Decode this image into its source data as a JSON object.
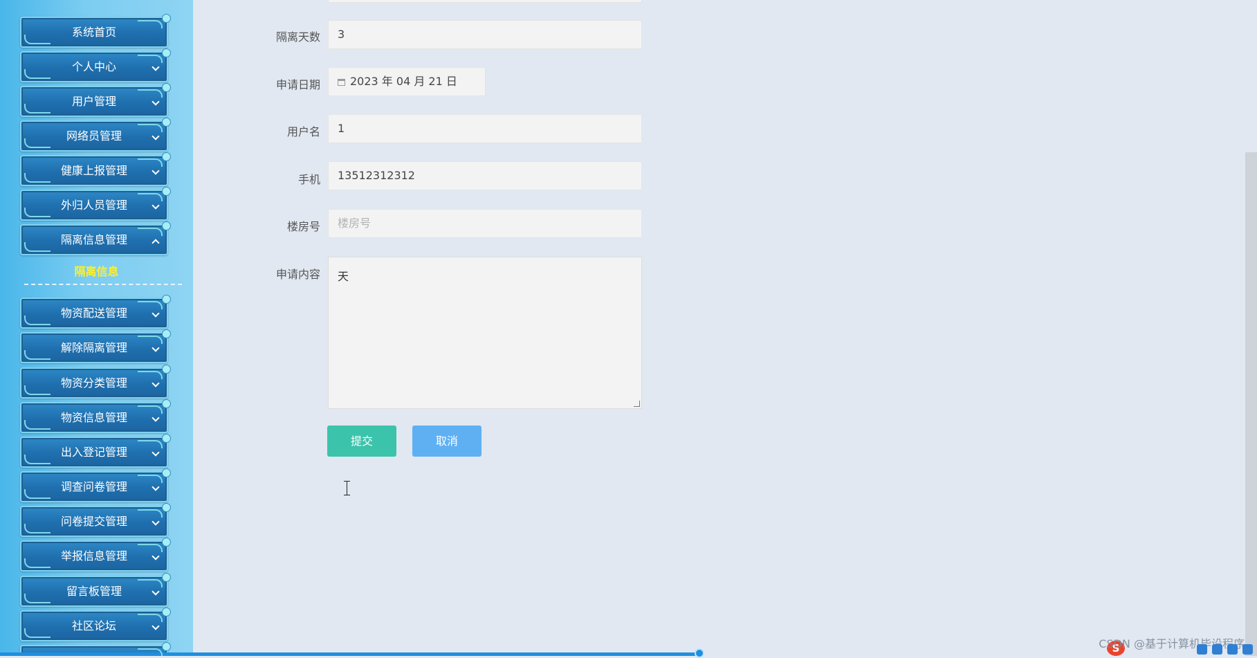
{
  "sidebar": {
    "items": [
      {
        "label": "系统首页"
      },
      {
        "label": "个人中心"
      },
      {
        "label": "用户管理"
      },
      {
        "label": "网络员管理"
      },
      {
        "label": "健康上报管理"
      },
      {
        "label": "外归人员管理"
      },
      {
        "label": "隔离信息管理"
      },
      {
        "label": "物资配送管理"
      },
      {
        "label": "解除隔离管理"
      },
      {
        "label": "物资分类管理"
      },
      {
        "label": "物资信息管理"
      },
      {
        "label": "出入登记管理"
      },
      {
        "label": "调查问卷管理"
      },
      {
        "label": "问卷提交管理"
      },
      {
        "label": "举报信息管理"
      },
      {
        "label": "留言板管理"
      },
      {
        "label": "社区论坛"
      }
    ],
    "expanded_submenu": {
      "label": "隔离信息"
    }
  },
  "form": {
    "quarantine_days": {
      "label": "隔离天数",
      "value": "3"
    },
    "apply_date": {
      "label": "申请日期",
      "value": "2023 年 04 月 21 日"
    },
    "username": {
      "label": "用户名",
      "value": "1"
    },
    "phone": {
      "label": "手机",
      "value": "13512312312"
    },
    "building": {
      "label": "楼房号",
      "placeholder": "楼房号"
    },
    "content": {
      "label": "申请内容",
      "value": "天"
    },
    "submit_label": "提交",
    "cancel_label": "取消"
  },
  "watermark": "CSDN @基于计算机毕设程序",
  "colors": {
    "page_bg": "#e1e8f1",
    "submit": "#3cc3ac",
    "cancel": "#5fb0f3",
    "menu": "#1f6fae",
    "submenu_text": "#ffef2a"
  }
}
